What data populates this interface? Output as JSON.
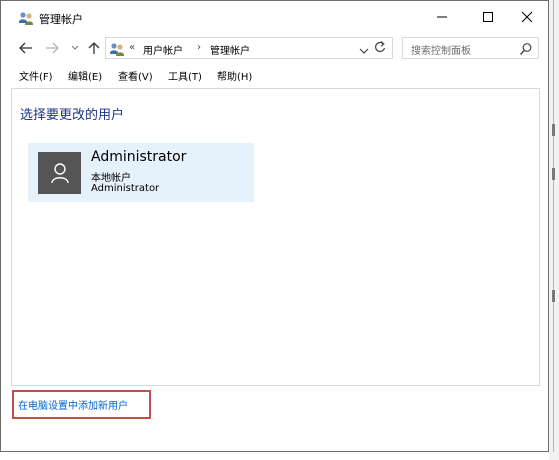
{
  "window": {
    "title": "管理帐户",
    "icon": "user-accounts-icon"
  },
  "nav": {
    "breadcrumb_overflow": "«",
    "breadcrumbs": [
      "用户帐户",
      "管理帐户"
    ],
    "breadcrumb_separator": "›"
  },
  "search": {
    "placeholder": "搜索控制面板"
  },
  "menu": {
    "items": [
      "文件(F)",
      "编辑(E)",
      "查看(V)",
      "工具(T)",
      "帮助(H)"
    ]
  },
  "main": {
    "heading": "选择要更改的用户",
    "account": {
      "name": "Administrator",
      "type": "本地帐户",
      "subtitle": "Administrator"
    },
    "add_user_link": "在电脑设置中添加新用户"
  },
  "colors": {
    "heading": "#1e3287",
    "tile_background": "#e5f1fb",
    "avatar_background": "#555555",
    "link": "#0066cc",
    "highlight_box": "#c0504d"
  }
}
